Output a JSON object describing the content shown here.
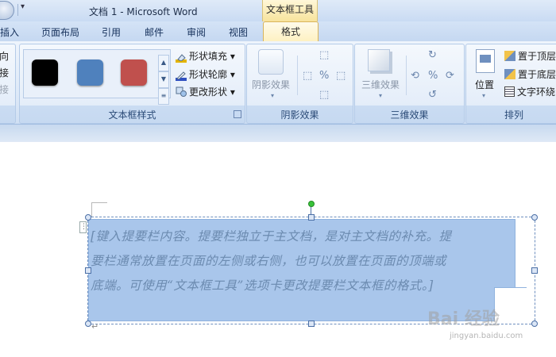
{
  "titlebar": {
    "title": "文档 1 - Microsoft Word",
    "contextual_tool": "文本框工具"
  },
  "tabs": [
    "插入",
    "页面布局",
    "引用",
    "邮件",
    "审阅",
    "视图"
  ],
  "active_tab": "格式",
  "ribbon": {
    "left_cut_items": [
      "向",
      "接",
      "接"
    ],
    "textbox_styles": {
      "label": "文本框样式",
      "swatches": [
        "#000000",
        "#4f81bd",
        "#c0504d"
      ],
      "commands": [
        "形状填充",
        "形状轮廓",
        "更改形状"
      ]
    },
    "shadow_effects": {
      "label": "阴影效果",
      "button": "阴影效果"
    },
    "effects_3d": {
      "label": "三维效果",
      "button": "三维效果"
    },
    "arrange": {
      "label": "排列",
      "position_button": "位置",
      "commands": [
        "置于顶层",
        "置于底层",
        "文字环绕"
      ]
    }
  },
  "document": {
    "textbox_lines": [
      "[键入提要栏内容。提要栏独立于主文档，是对主文档的补充。提",
      "要栏通常放置在页面的左侧或右侧，也可以放置在页面的顶端或",
      "底端。可使用“文本框工具”选项卡更改提要栏文本框的格式。]"
    ],
    "para_mark": "↵"
  },
  "watermark": {
    "main": "Bai 经验",
    "sub": "jingyan.baidu.com"
  }
}
